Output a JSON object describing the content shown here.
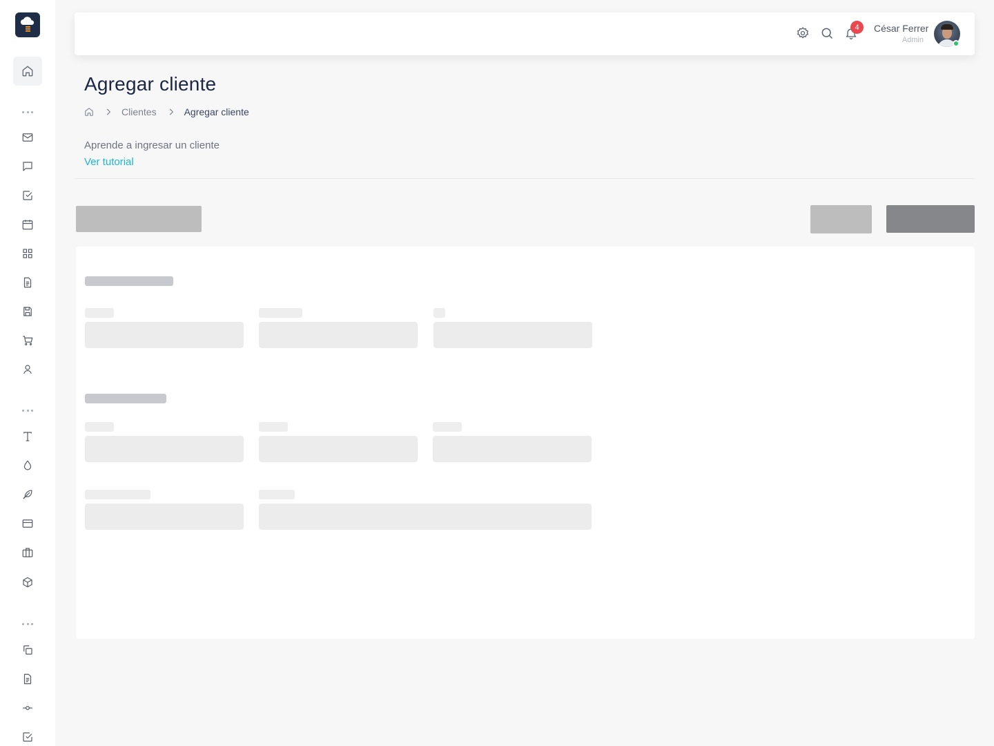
{
  "topbar": {
    "notification_count": "4",
    "user_name": "César Ferrer",
    "user_role": "Admin"
  },
  "page": {
    "title": "Agregar cliente",
    "breadcrumb": [
      "Clientes",
      "Agregar cliente"
    ],
    "help_text": "Aprende a ingresar un cliente",
    "help_link": "Ver tutorial"
  },
  "colors": {
    "accent": "#1bb6d6",
    "badge": "#e8484e",
    "online": "#2dc26b",
    "logo_bg": "#1f2d47"
  },
  "sidebar_icons": [
    "home-icon",
    "mail-icon",
    "chat-icon",
    "check-square-icon",
    "calendar-icon",
    "grid-icon",
    "document-icon",
    "save-icon",
    "cart-icon",
    "user-icon",
    "type-icon",
    "droplet-icon",
    "feather-icon",
    "credit-card-icon",
    "briefcase-icon",
    "box-icon",
    "copy-icon",
    "file-text-icon",
    "git-commit-icon",
    "check-square-icon"
  ],
  "state": "loading-skeleton"
}
